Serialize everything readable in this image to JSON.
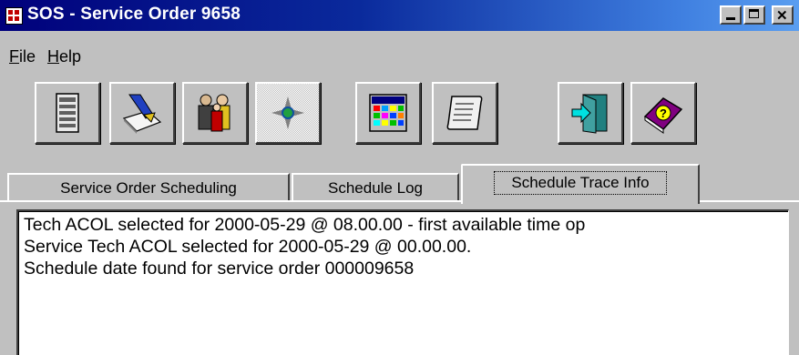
{
  "window": {
    "title": "SOS - Service Order 9658",
    "icon": "app-grid-icon"
  },
  "menu": {
    "items": [
      "File",
      "Help"
    ]
  },
  "toolbar": {
    "buttons": [
      {
        "icon": "document-list-icon"
      },
      {
        "icon": "edit-pen-icon"
      },
      {
        "icon": "people-icon"
      },
      {
        "icon": "compass-icon"
      },
      {
        "icon": "calendar-grid-icon"
      },
      {
        "icon": "scroll-icon"
      },
      {
        "icon": "exit-door-icon"
      },
      {
        "icon": "help-book-icon"
      }
    ]
  },
  "tabs": [
    {
      "label": "Service Order Scheduling",
      "active": false
    },
    {
      "label": "Schedule Log",
      "active": false
    },
    {
      "label": "Schedule Trace Info",
      "active": true
    }
  ],
  "trace": {
    "lines": [
      "Tech ACOL selected for 2000-05-29 @ 08.00.00 - first available time op",
      "Service Tech ACOL selected for 2000-05-29 @ 00.00.00.",
      "Schedule date found for service order 000009658"
    ]
  }
}
